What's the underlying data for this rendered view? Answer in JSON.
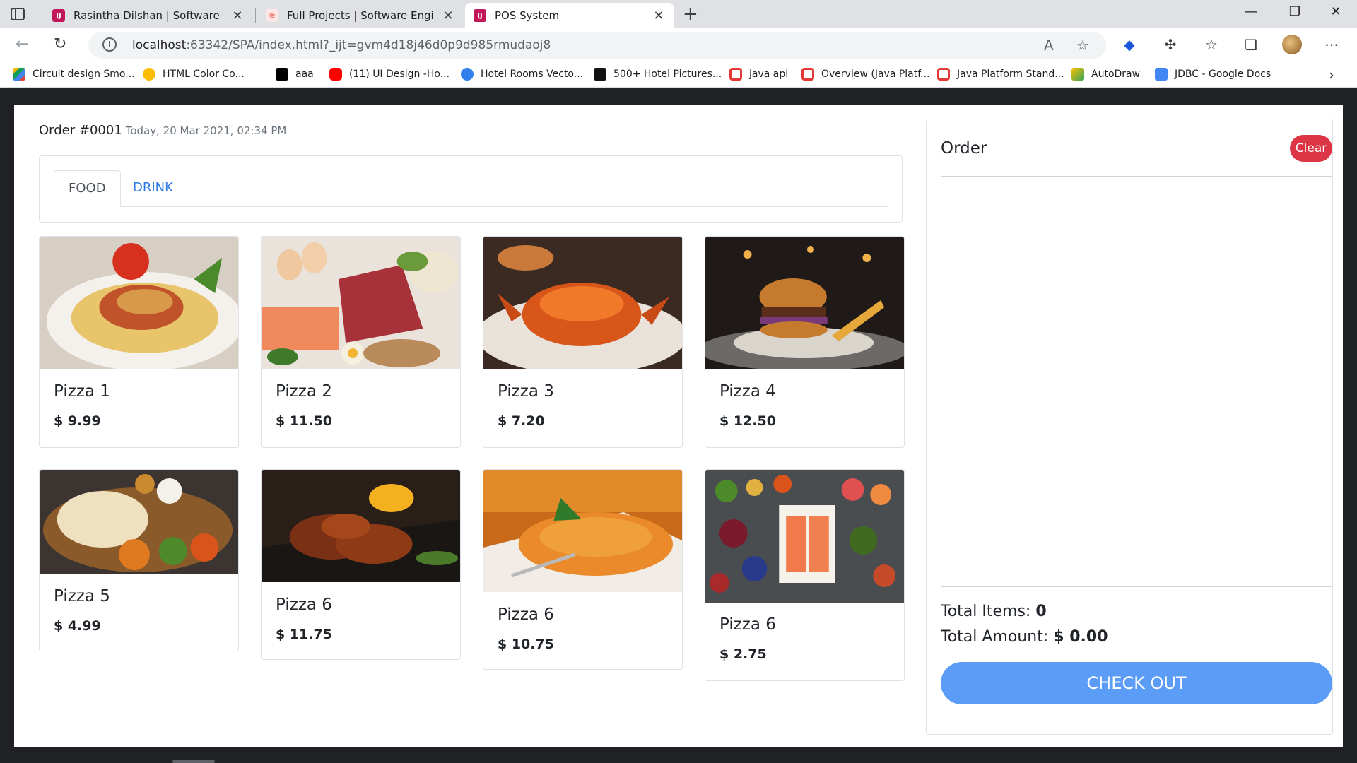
{
  "browser": {
    "tabs": [
      {
        "title": "Rasintha Dilshan | Software Engi",
        "close": "✕"
      },
      {
        "title": "Full Projects | Software Engineer",
        "close": "✕"
      },
      {
        "title": "POS System",
        "close": "✕"
      }
    ],
    "new_tab": "+",
    "window_controls": {
      "minimize": "—",
      "restore": "❐",
      "close": "✕"
    },
    "url": {
      "host": "localhost",
      "path": ":63342/SPA/index.html?_ijt=gvm4d18j46d0p9d985rmudaoj8"
    },
    "bookmarks": [
      {
        "label": "Circuit design Smo..."
      },
      {
        "label": "HTML Color Co..."
      },
      {
        "label": "aaa"
      },
      {
        "label": "(11) UI Design -Ho..."
      },
      {
        "label": "Hotel Rooms Vecto..."
      },
      {
        "label": "500+ Hotel Pictures..."
      },
      {
        "label": "java api"
      },
      {
        "label": "Overview (Java Platf..."
      },
      {
        "label": "Java Platform Stand..."
      },
      {
        "label": "AutoDraw"
      },
      {
        "label": "JDBC - Google Docs"
      }
    ]
  },
  "order_header": {
    "title": "Order #0001",
    "date": "Today, 20 Mar 2021, 02:34 PM"
  },
  "category_tabs": [
    {
      "label": "FOOD"
    },
    {
      "label": "DRINK"
    }
  ],
  "products": [
    {
      "name": "Pizza 1",
      "price": "$ 9.99"
    },
    {
      "name": "Pizza 2",
      "price": "$ 11.50"
    },
    {
      "name": "Pizza 3",
      "price": "$ 7.20"
    },
    {
      "name": "Pizza 4",
      "price": "$ 12.50"
    },
    {
      "name": "Pizza 5",
      "price": "$ 4.99"
    },
    {
      "name": "Pizza 6",
      "price": "$ 11.75"
    },
    {
      "name": "Pizza 6",
      "price": "$ 10.75"
    },
    {
      "name": "Pizza 6",
      "price": "$ 2.75"
    }
  ],
  "order_panel": {
    "title": "Order",
    "clear_label": "Clear",
    "total_items_label": "Total Items:",
    "total_items_value": "0",
    "total_amount_label": "Total Amount:",
    "total_amount_value": "$ 0.00",
    "checkout_label": "CHECK OUT"
  },
  "colors": {
    "clear": "#dc3545",
    "checkout": "#5b9cf6",
    "active_link": "#2c7be5"
  }
}
